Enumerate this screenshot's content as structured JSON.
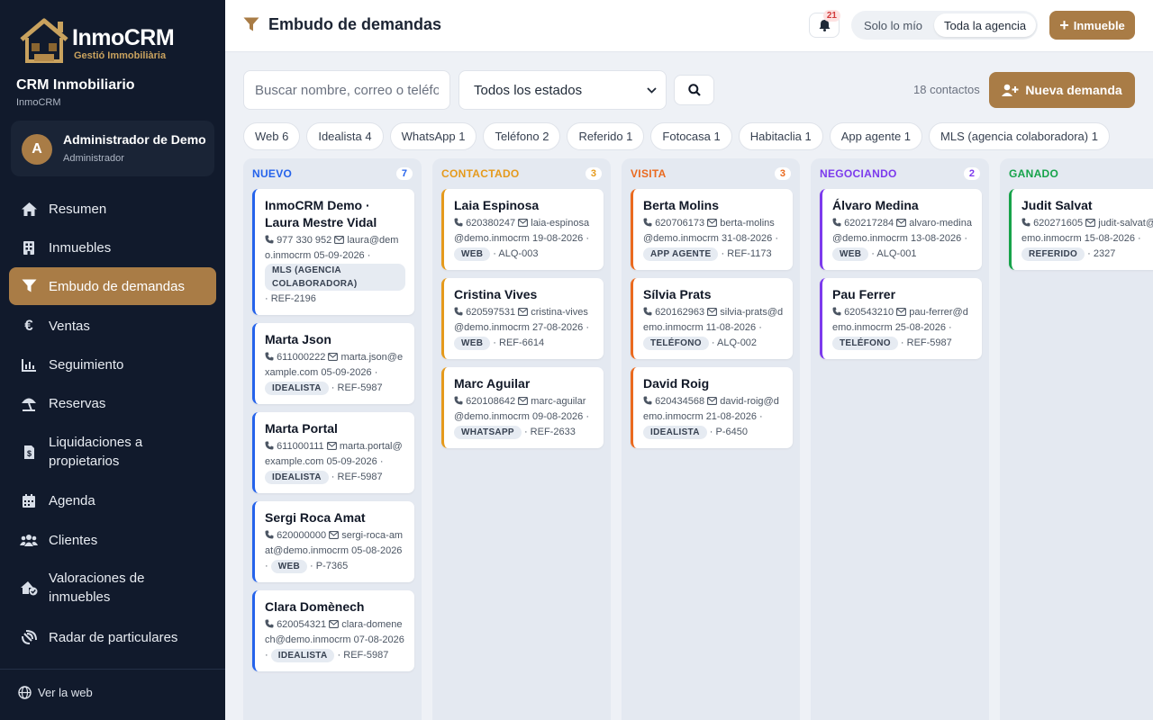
{
  "brand": {
    "name": "InmoCRM",
    "tagline": "Gestió Immobiliària"
  },
  "sidebar": {
    "title": "CRM Inmobiliario",
    "subtitle": "InmoCRM",
    "user": {
      "initial": "A",
      "name": "Administrador de Demo",
      "role": "Administrador"
    },
    "items": [
      {
        "label": "Resumen",
        "icon": "home-icon"
      },
      {
        "label": "Inmuebles",
        "icon": "building-icon"
      },
      {
        "label": "Embudo de demandas",
        "icon": "funnel-icon",
        "active": true
      },
      {
        "label": "Ventas",
        "icon": "euro-icon"
      },
      {
        "label": "Seguimiento",
        "icon": "chart-icon"
      },
      {
        "label": "Reservas",
        "icon": "umbrella-icon"
      },
      {
        "label": "Liquidaciones a propietarios",
        "icon": "invoice-icon"
      },
      {
        "label": "Agenda",
        "icon": "calendar-icon"
      },
      {
        "label": "Clientes",
        "icon": "users-icon"
      },
      {
        "label": "Valoraciones de inmuebles",
        "icon": "house-check-icon"
      },
      {
        "label": "Radar de particulares",
        "icon": "radar-icon"
      }
    ],
    "footer_link": "Ver la web"
  },
  "header": {
    "title": "Embudo de demandas",
    "notifications": "21",
    "scope_options": [
      "Solo lo mío",
      "Toda la agencia"
    ],
    "scope_selected": "Toda la agencia",
    "new_property_label": "Inmueble"
  },
  "toolbar": {
    "search_placeholder": "Buscar nombre, correo o teléfono",
    "state_filter": "Todos los estados",
    "contacts_count": "18 contactos",
    "new_demand_label": "Nueva demanda"
  },
  "sources": [
    "Web 6",
    "Idealista 4",
    "WhatsApp 1",
    "Teléfono 2",
    "Referido 1",
    "Fotocasa 1",
    "Habitaclia 1",
    "App agente 1",
    "MLS (agencia colaboradora) 1"
  ],
  "colors": {
    "accent": "#a97c46",
    "sidebar_bg": "#111a2c",
    "nuevo": "#2563eb",
    "contactado": "#e59a1c",
    "visita": "#ea6a1f",
    "negociando": "#7c3aed",
    "ganado": "#16a34a"
  },
  "columns": [
    {
      "title": "NUEVO",
      "count": "7",
      "color": "#2563eb",
      "cards": [
        {
          "name": "InmoCRM Demo · Laura Mestre Vidal",
          "phone": "977 330 952",
          "email": "laura@demo.inmocrm",
          "date": "05-09-2026",
          "source": "MLS (AGENCIA COLABORADORA)",
          "ref": "REF-2196"
        },
        {
          "name": "Marta Json",
          "phone": "611000222",
          "email": "marta.json@example.com",
          "date": "05-09-2026",
          "source": "IDEALISTA",
          "ref": "REF-5987"
        },
        {
          "name": "Marta Portal",
          "phone": "611000111",
          "email": "marta.portal@example.com",
          "date": "05-09-2026",
          "source": "IDEALISTA",
          "ref": "REF-5987"
        },
        {
          "name": "Sergi Roca Amat",
          "phone": "620000000",
          "email": "sergi-roca-amat@demo.inmocrm",
          "date": "05-08-2026",
          "source": "WEB",
          "ref": "P-7365"
        },
        {
          "name": "Clara Domènech",
          "phone": "620054321",
          "email": "clara-domenech@demo.inmocrm",
          "date": "07-08-2026",
          "source": "IDEALISTA",
          "ref": "REF-5987"
        }
      ]
    },
    {
      "title": "CONTACTADO",
      "count": "3",
      "color": "#e59a1c",
      "cards": [
        {
          "name": "Laia Espinosa",
          "phone": "620380247",
          "email": "laia-espinosa@demo.inmocrm",
          "date": "19-08-2026",
          "source": "WEB",
          "ref": "ALQ-003"
        },
        {
          "name": "Cristina Vives",
          "phone": "620597531",
          "email": "cristina-vives@demo.inmocrm",
          "date": "27-08-2026",
          "source": "WEB",
          "ref": "REF-6614"
        },
        {
          "name": "Marc Aguilar",
          "phone": "620108642",
          "email": "marc-aguilar@demo.inmocrm",
          "date": "09-08-2026",
          "source": "WHATSAPP",
          "ref": "REF-2633"
        }
      ]
    },
    {
      "title": "VISITA",
      "count": "3",
      "color": "#ea6a1f",
      "cards": [
        {
          "name": "Berta Molins",
          "phone": "620706173",
          "email": "berta-molins@demo.inmocrm",
          "date": "31-08-2026",
          "source": "APP AGENTE",
          "ref": "REF-1173"
        },
        {
          "name": "Sílvia Prats",
          "phone": "620162963",
          "email": "silvia-prats@demo.inmocrm",
          "date": "11-08-2026",
          "source": "TELÉFONO",
          "ref": "ALQ-002"
        },
        {
          "name": "David Roig",
          "phone": "620434568",
          "email": "david-roig@demo.inmocrm",
          "date": "21-08-2026",
          "source": "IDEALISTA",
          "ref": "P-6450"
        }
      ]
    },
    {
      "title": "NEGOCIANDO",
      "count": "2",
      "color": "#7c3aed",
      "cards": [
        {
          "name": "Álvaro Medina",
          "phone": "620217284",
          "email": "alvaro-medina@demo.inmocrm",
          "date": "13-08-2026",
          "source": "WEB",
          "ref": "ALQ-001"
        },
        {
          "name": "Pau Ferrer",
          "phone": "620543210",
          "email": "pau-ferrer@demo.inmocrm",
          "date": "25-08-2026",
          "source": "TELÉFONO",
          "ref": "REF-5987"
        }
      ]
    },
    {
      "title": "GANADO",
      "count": "",
      "color": "#16a34a",
      "cards": [
        {
          "name": "Judit Salvat",
          "phone": "620271605",
          "email": "judit-salvat@demo.inmocrm",
          "date": "15-08-2026",
          "source": "REFERIDO",
          "ref": "2327"
        }
      ]
    }
  ]
}
